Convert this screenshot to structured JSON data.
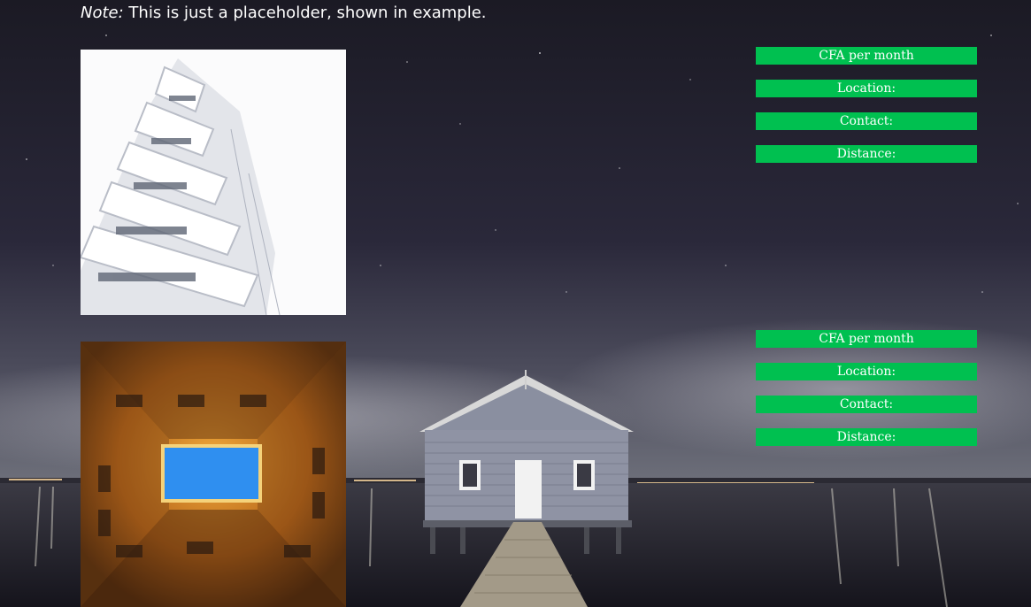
{
  "note": {
    "label": "Note:",
    "text": "This is just a placeholder, shown in example."
  },
  "listings": [
    {
      "image_icon": "building-photo",
      "price_label": "CFA per month",
      "location_label": "Location:",
      "contact_label": "Contact:",
      "distance_label": "Distance:"
    },
    {
      "image_icon": "courtyard-photo",
      "price_label": "CFA per month",
      "location_label": "Location:",
      "contact_label": "Contact:",
      "distance_label": "Distance:"
    }
  ],
  "colors": {
    "accent": "#00c050",
    "text": "#ffffff",
    "background": "#1d1b29"
  }
}
